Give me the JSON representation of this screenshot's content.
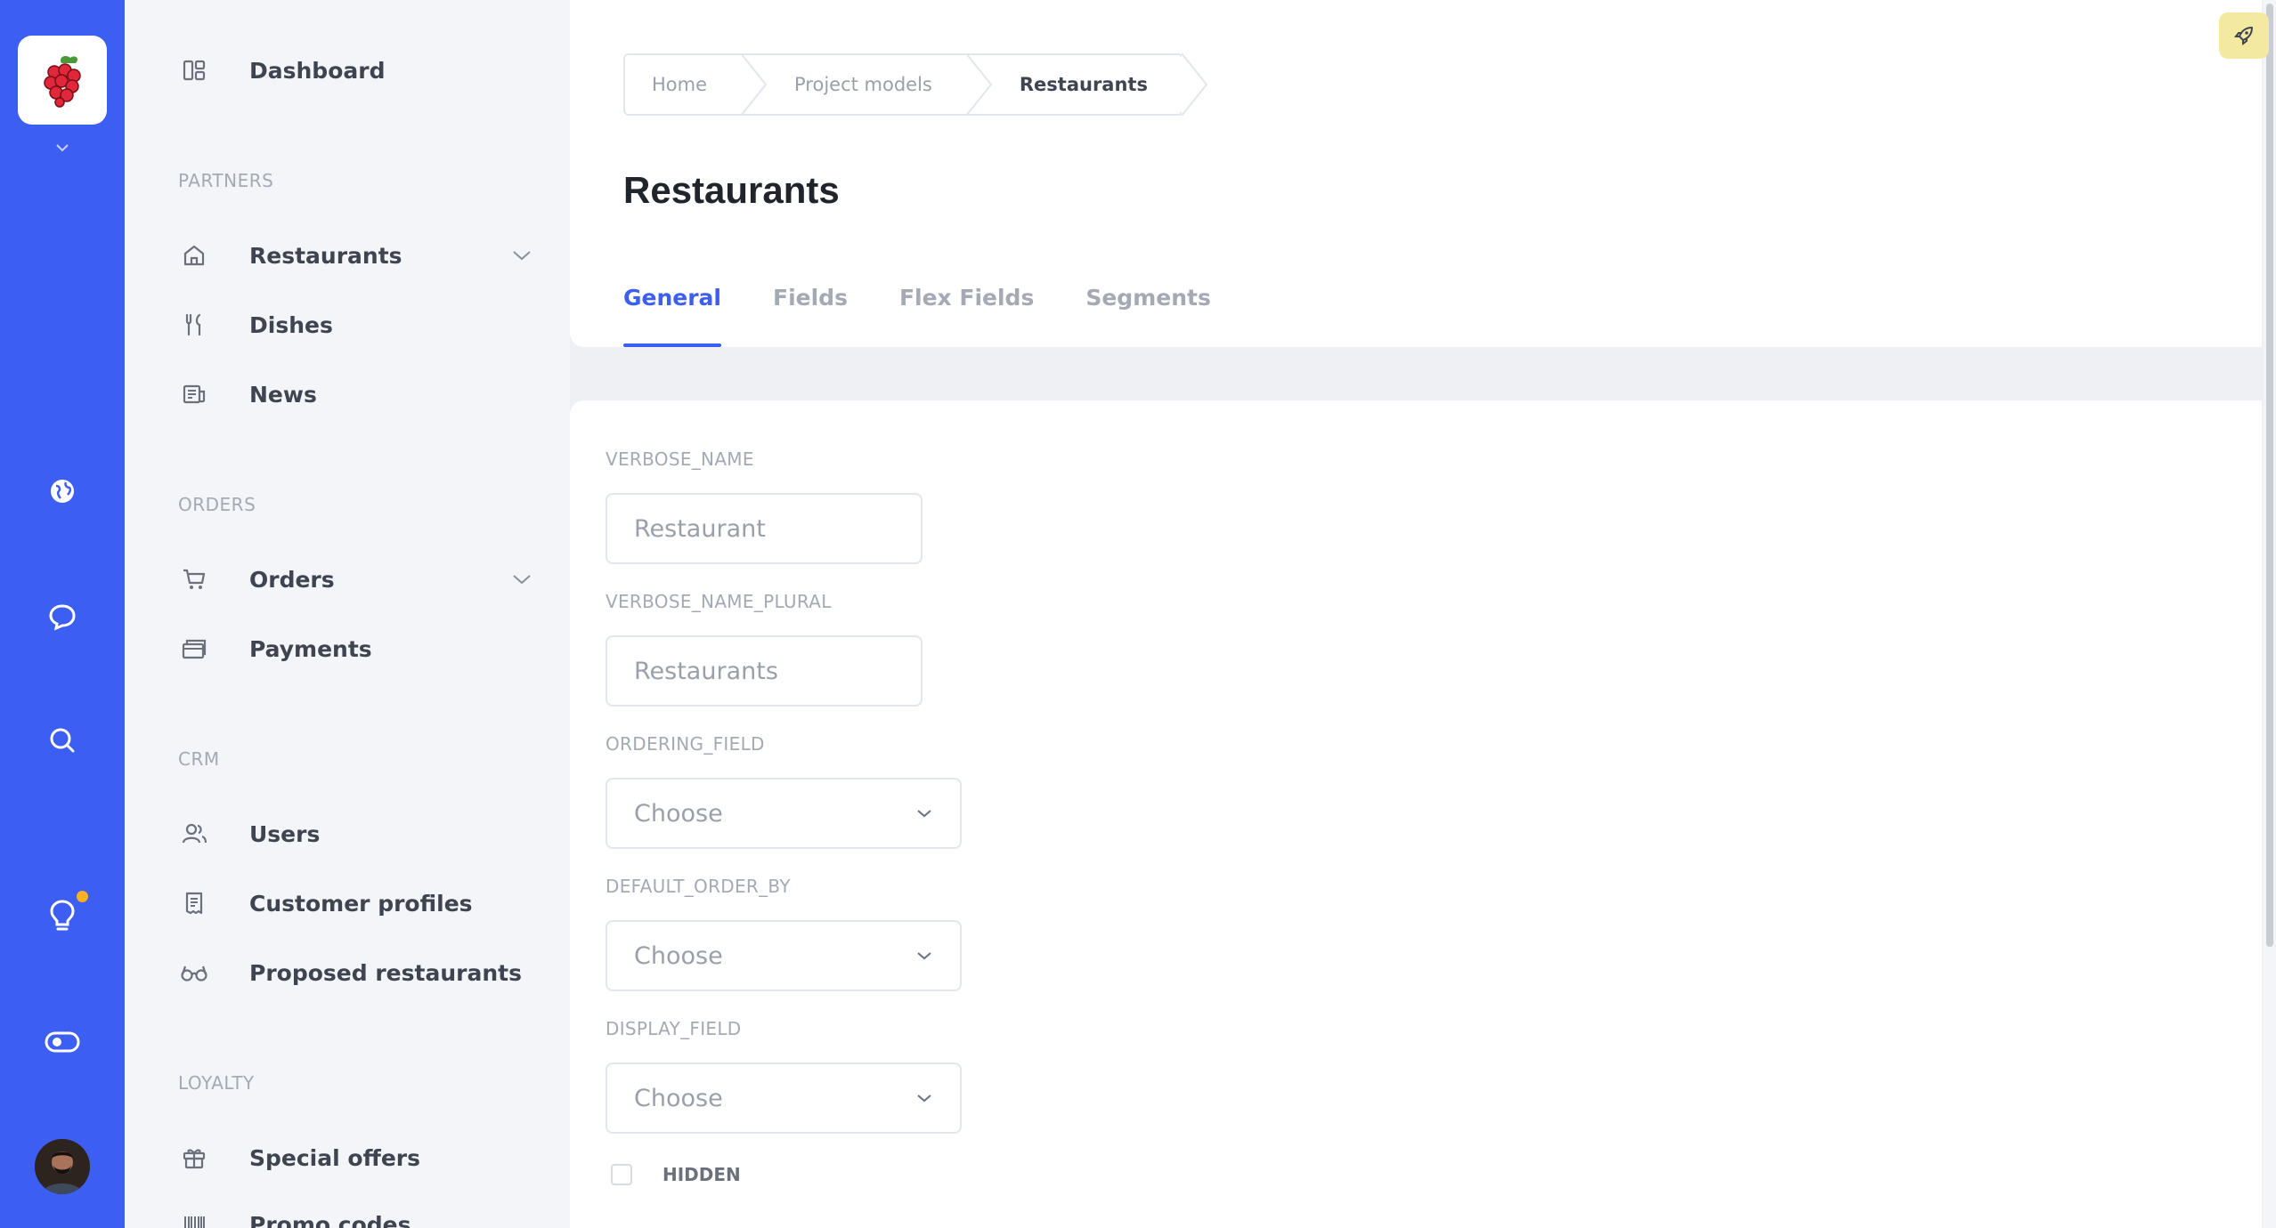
{
  "rail": {
    "icons": [
      "globe-icon",
      "chat-icon",
      "search-icon",
      "lightbulb-icon",
      "toggle-icon"
    ],
    "notification_dot_color": "#ffb020"
  },
  "sidebar": {
    "dashboard": "Dashboard",
    "sections": {
      "partners": "PARTNERS",
      "orders": "ORDERS",
      "crm": "CRM",
      "loyalty": "LOYALTY"
    },
    "items": {
      "restaurants": "Restaurants",
      "dishes": "Dishes",
      "news": "News",
      "orders": "Orders",
      "payments": "Payments",
      "users": "Users",
      "customer_profiles": "Customer profiles",
      "proposed_restaurants": "Proposed restaurants",
      "special_offers": "Special offers",
      "promo_codes": "Promo codes"
    }
  },
  "breadcrumb": [
    "Home",
    "Project models",
    "Restaurants"
  ],
  "page": {
    "title": "Restaurants"
  },
  "tabs": [
    "General",
    "Fields",
    "Flex Fields",
    "Segments"
  ],
  "form": {
    "verbose_name": {
      "label": "VERBOSE_NAME",
      "placeholder": "Restaurant"
    },
    "verbose_name_plural": {
      "label": "VERBOSE_NAME_PLURAL",
      "placeholder": "Restaurants"
    },
    "ordering_field": {
      "label": "ORDERING_FIELD",
      "value": "Choose"
    },
    "default_order_by": {
      "label": "DEFAULT_ORDER_BY",
      "value": "Choose"
    },
    "display_field": {
      "label": "DISPLAY_FIELD",
      "value": "Choose"
    },
    "hidden": {
      "label": "HIDDEN"
    }
  },
  "colors": {
    "accent": "#3d5ef2",
    "rail": "#3d5ef2"
  }
}
